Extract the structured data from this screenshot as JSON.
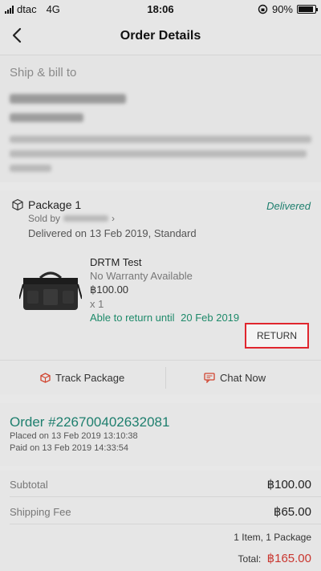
{
  "status_bar": {
    "carrier": "dtac",
    "network": "4G",
    "time": "18:06",
    "battery_label": "90%",
    "battery_level": 0.9
  },
  "nav": {
    "title": "Order Details"
  },
  "ship": {
    "heading": "Ship & bill to"
  },
  "package": {
    "label": "Package 1",
    "sold_by": "Sold by",
    "delivered_on": "Delivered on 13 Feb 2019, Standard",
    "status": "Delivered",
    "product": {
      "name": "DRTM Test",
      "warranty": "No Warranty Available",
      "price": "฿100.00",
      "qty": "x 1",
      "return_until_label": "Able to return until",
      "return_until_date": "20 Feb 2019"
    },
    "return_button": "RETURN",
    "track_label": "Track Package",
    "chat_label": "Chat Now"
  },
  "order": {
    "number": "Order #226700402632081",
    "placed": "Placed on 13 Feb 2019  13:10:38",
    "paid": "Paid on 13 Feb 2019  14:33:54"
  },
  "totals": {
    "subtotal_label": "Subtotal",
    "subtotal_value": "฿100.00",
    "shipping_label": "Shipping Fee",
    "shipping_value": "฿65.00",
    "items_summary": "1 Item, 1 Package",
    "total_label": "Total:",
    "total_value": "฿165.00"
  },
  "colors": {
    "accent_green": "#1e7f6e",
    "total_red": "#c9362f",
    "return_border": "#e0262e"
  }
}
